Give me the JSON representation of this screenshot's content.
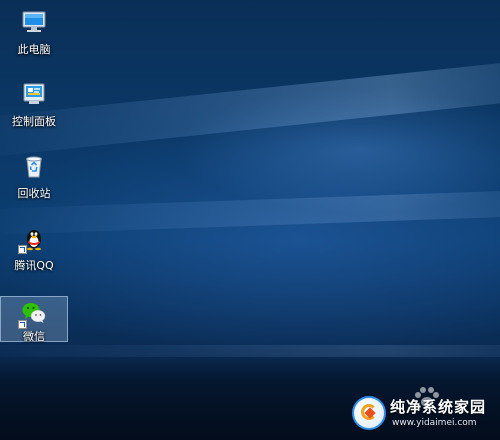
{
  "desktop": {
    "icons": [
      {
        "label": "此电脑",
        "icon": "computer-icon",
        "selected": false
      },
      {
        "label": "控制面板",
        "icon": "control-panel-icon",
        "selected": false
      },
      {
        "label": "回收站",
        "icon": "recycle-bin-icon",
        "selected": false
      },
      {
        "label": "腾讯QQ",
        "icon": "qq-penguin-icon",
        "selected": false
      },
      {
        "label": "微信",
        "icon": "wechat-icon",
        "selected": true
      }
    ]
  },
  "watermark": {
    "title": "纯净系统家园",
    "url": "www.yidaimei.com"
  },
  "colors": {
    "wallpaper_blue": "#0b3a6a",
    "selection": "#b4d2f0",
    "wechat_green": "#2dc100",
    "qq_yellow": "#f7b500"
  }
}
